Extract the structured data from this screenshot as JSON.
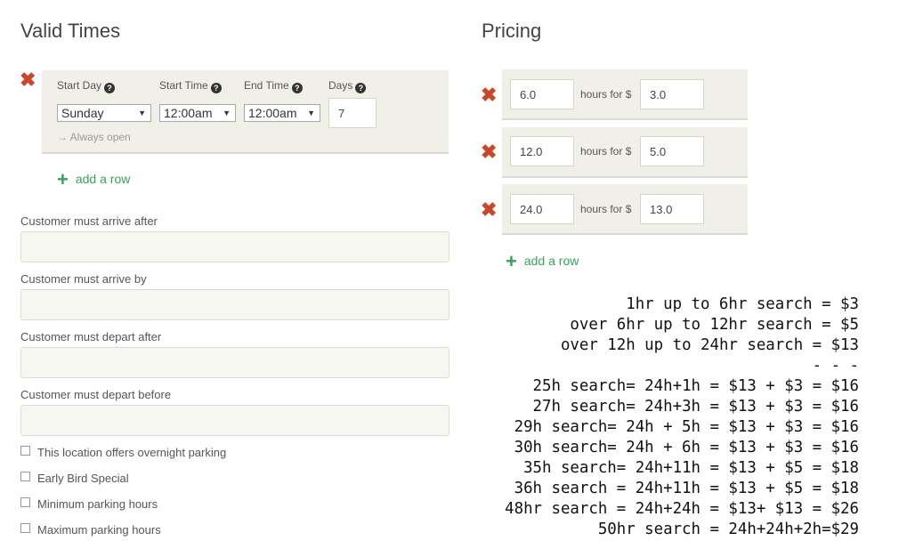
{
  "valid_times": {
    "title": "Valid Times",
    "headers": {
      "start_day": "Start Day",
      "start_time": "Start Time",
      "end_time": "End Time",
      "days": "Days"
    },
    "row": {
      "start_day": "Sunday",
      "start_time": "12:00am",
      "end_time": "12:00am",
      "days": "7",
      "note": "→ Always open"
    },
    "add_row": "add a row"
  },
  "fields": {
    "arrive_after": "Customer must arrive after",
    "arrive_by": "Customer must arrive by",
    "depart_after": "Customer must depart after",
    "depart_before": "Customer must depart before"
  },
  "checkboxes": [
    "This location offers overnight parking",
    "Early Bird Special",
    "Minimum parking hours",
    "Maximum parking hours"
  ],
  "pricing": {
    "title": "Pricing",
    "rows": [
      {
        "hours": "6.0",
        "label": "hours for $",
        "price": "3.0"
      },
      {
        "hours": "12.0",
        "label": "hours for $",
        "price": "5.0"
      },
      {
        "hours": "24.0",
        "label": "hours for $",
        "price": "13.0"
      }
    ],
    "add_row": "add a row"
  },
  "notes": [
    "1hr up to 6hr search = $3",
    "over 6hr up to 12hr search = $5",
    "over 12h up to 24hr search = $13",
    "- - -",
    "25h search= 24h+1h = $13 + $3 = $16",
    "27h search= 24h+3h = $13 + $3 = $16",
    "29h search= 24h + 5h = $13 + $3 = $16",
    "30h search= 24h + 6h = $13 + $3 = $16",
    "35h search= 24h+11h = $13 + $5 = $18",
    "36h search = 24h+11h = $13 + $5 = $18",
    "48hr search = 24h+24h = $13+ $13 = $26",
    "50hr search = 24h+24h+2h=$29"
  ],
  "icons": {
    "remove": "close-icon",
    "add": "plus-icon",
    "help": "help-icon"
  }
}
